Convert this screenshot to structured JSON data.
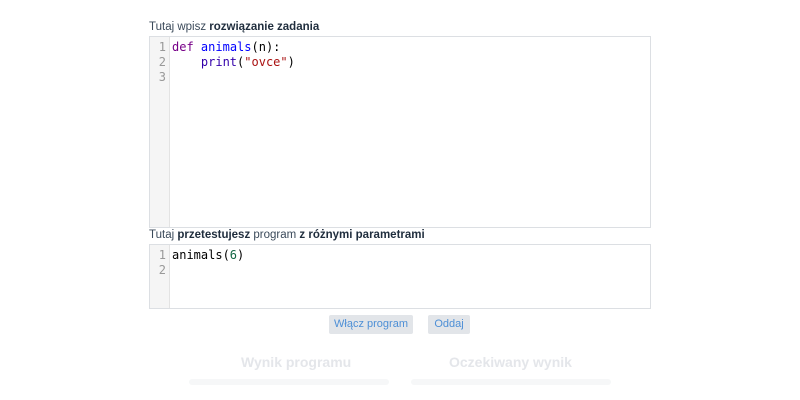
{
  "solution": {
    "label_prefix": "Tutaj wpisz ",
    "label_bold": "rozwiązanie zadania",
    "line_numbers": [
      "1",
      "2",
      "3"
    ],
    "lines": [
      [
        {
          "t": "def",
          "c": "kw"
        },
        {
          "t": " ",
          "c": ""
        },
        {
          "t": "animals",
          "c": "fn"
        },
        {
          "t": "(n):",
          "c": ""
        }
      ],
      [
        {
          "t": "    ",
          "c": ""
        },
        {
          "t": "print",
          "c": "bi"
        },
        {
          "t": "(",
          "c": ""
        },
        {
          "t": "\"ovce\"",
          "c": "str"
        },
        {
          "t": ")",
          "c": ""
        }
      ],
      []
    ]
  },
  "test": {
    "label_part1": "Tutaj ",
    "label_bold1": "przetestujesz",
    "label_part2": " program ",
    "label_bold2": "z różnymi parametrami",
    "line_numbers": [
      "1",
      "2"
    ],
    "lines": [
      [
        {
          "t": "animals(",
          "c": ""
        },
        {
          "t": "6",
          "c": "num"
        },
        {
          "t": ")",
          "c": ""
        }
      ],
      []
    ]
  },
  "buttons": {
    "run_label": "Włącz program",
    "submit_label": "Oddaj"
  },
  "results": {
    "program_output_heading": "Wynik programu",
    "expected_output_heading": "Oczekiwany wynik"
  },
  "colors": {
    "keyword": "#770088",
    "function_name": "#0000ff",
    "builtin": "#3300aa",
    "string": "#aa1111",
    "number": "#116644",
    "button_text": "#4d8fd6",
    "button_bg": "#e2e5e9"
  }
}
